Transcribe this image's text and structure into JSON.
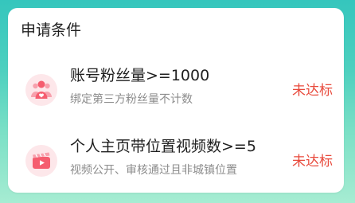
{
  "card": {
    "title": "申请条件"
  },
  "conditions": [
    {
      "title": "账号粉丝量>=1000",
      "subtitle": "绑定第三方粉丝量不计数",
      "status": "未达标",
      "icon": "followers-icon"
    },
    {
      "title": "个人主页带位置视频数>=5",
      "subtitle": "视频公开、审核通过且非城镇位置",
      "status": "未达标",
      "icon": "video-clapper-icon"
    }
  ],
  "colors": {
    "status": "#e84a3c",
    "icon_bg": "#fde7ea",
    "icon_fg": "#f55d6f",
    "accent_bg_top": "#35c6bd"
  }
}
